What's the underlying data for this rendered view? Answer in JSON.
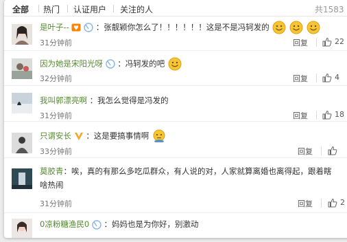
{
  "tabs": [
    {
      "label": "全部"
    },
    {
      "label": "热门"
    },
    {
      "label": "认证用户"
    },
    {
      "label": "关注的人"
    }
  ],
  "total_count": "共1583",
  "comments": [
    {
      "user": "是叶子--",
      "text": "：张靓颖你怎么了！！！！！！这是不是冯轲发的",
      "time": "31分钟前",
      "reply": "回复",
      "likes": "22"
    },
    {
      "user": "因为她是宋阳光呀",
      "text": "：冯轲发的吧",
      "time": "32分钟前",
      "reply": "回复",
      "likes": "4"
    },
    {
      "user": "我叫郭漂亮啊",
      "text": "：我怎么觉得是冯发的",
      "time": "31分钟前",
      "reply": "回复",
      "likes": "18"
    },
    {
      "user": "只谓安长",
      "text": "：这是要搞事情啊",
      "time": "33分钟前",
      "reply": "回复",
      "likes": ""
    },
    {
      "user": "莫胶青",
      "text": "：唉，真的有那么多吃瓜群众，有人说的对，人家就算离婚也离得起，跟着瞎",
      "text2": "啥热闹",
      "time": "31分钟前",
      "reply": "回复",
      "likes": "2"
    },
    {
      "user": "0凉粉糖渔民0",
      "text": "：妈妈也是为你好，别激动"
    }
  ],
  "colors": {
    "username": "#558b2f",
    "accent_orange": "#ff8200",
    "emoji": "#f7c531"
  }
}
